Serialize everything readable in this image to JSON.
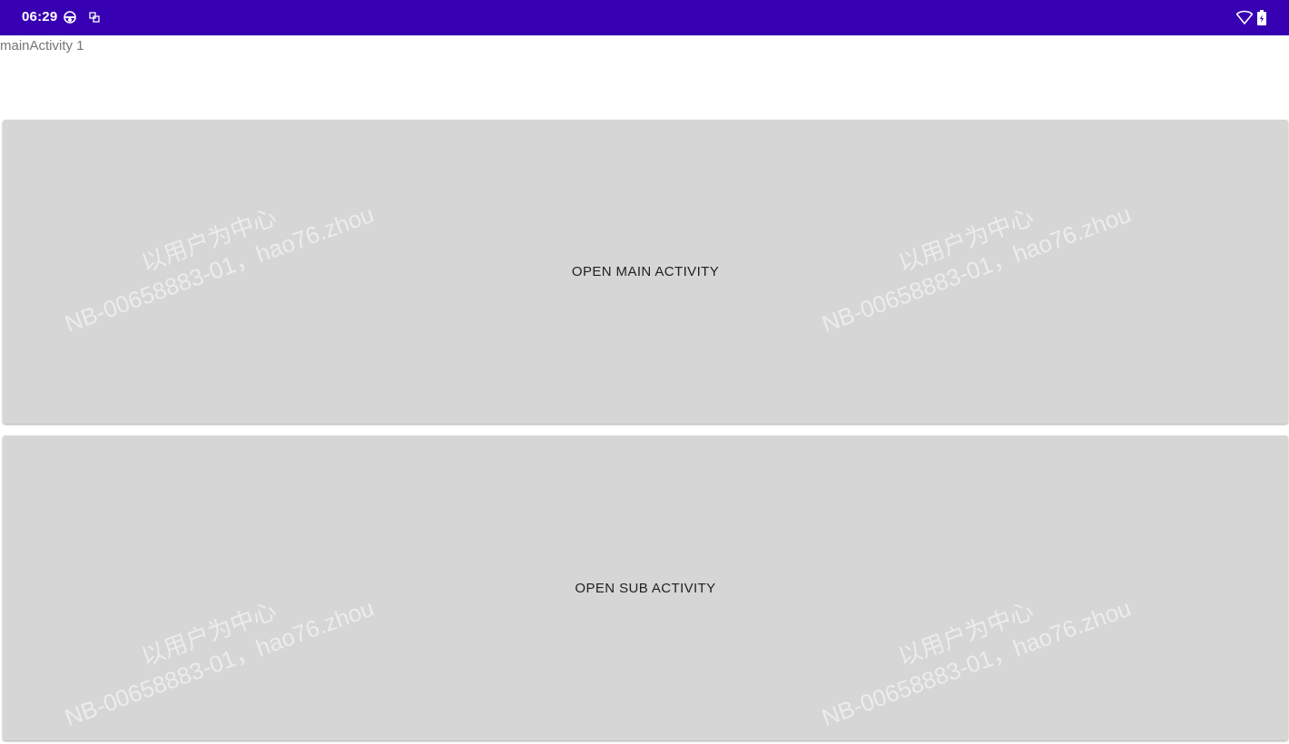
{
  "status_bar": {
    "time": "06:29",
    "background_color": "#3700b3",
    "icons": [
      "notification-icon",
      "sync-icon",
      "wifi-icon",
      "battery-icon"
    ]
  },
  "activity": {
    "label": "mainActivity 1"
  },
  "buttons": {
    "open_main": "OPEN MAIN ACTIVITY",
    "open_sub": "OPEN SUB ACTIVITY",
    "background_color": "#d6d6d6"
  },
  "watermark": {
    "line1": "以用户为中心",
    "line2": "NB-00658883-01，hao76.zhou"
  }
}
